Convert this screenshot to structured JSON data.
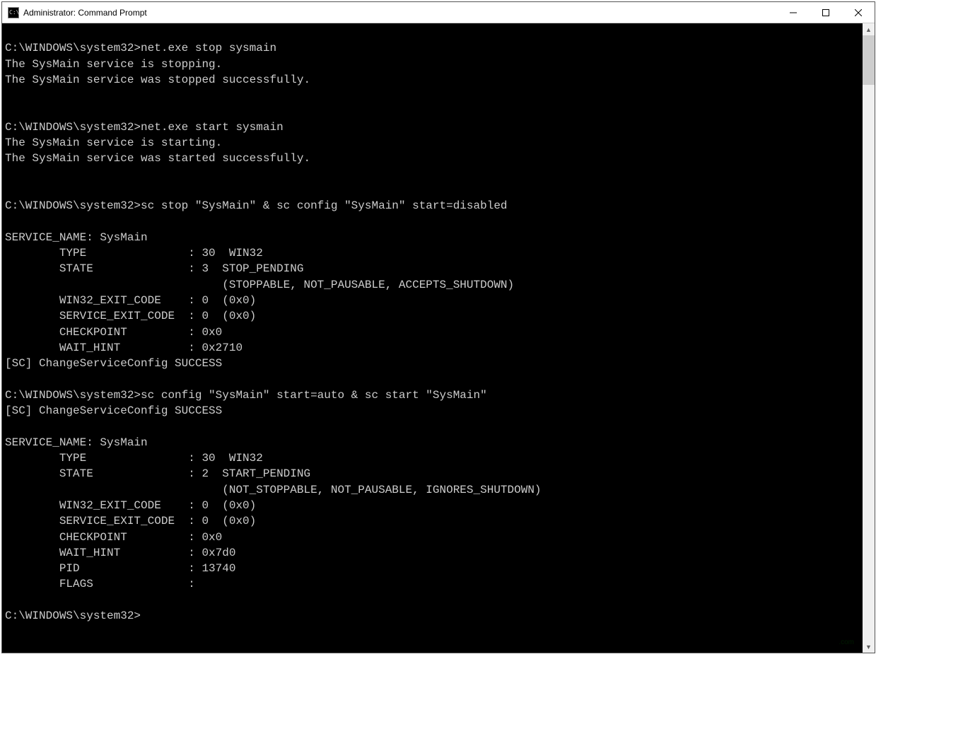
{
  "window": {
    "title": "Administrator: Command Prompt",
    "icon_label": "C:\\"
  },
  "terminal": {
    "lines": [
      "",
      "C:\\WINDOWS\\system32>net.exe stop sysmain",
      "The SysMain service is stopping.",
      "The SysMain service was stopped successfully.",
      "",
      "",
      "C:\\WINDOWS\\system32>net.exe start sysmain",
      "The SysMain service is starting.",
      "The SysMain service was started successfully.",
      "",
      "",
      "C:\\WINDOWS\\system32>sc stop \"SysMain\" & sc config \"SysMain\" start=disabled",
      "",
      "SERVICE_NAME: SysMain",
      "        TYPE               : 30  WIN32",
      "        STATE              : 3  STOP_PENDING",
      "                                (STOPPABLE, NOT_PAUSABLE, ACCEPTS_SHUTDOWN)",
      "        WIN32_EXIT_CODE    : 0  (0x0)",
      "        SERVICE_EXIT_CODE  : 0  (0x0)",
      "        CHECKPOINT         : 0x0",
      "        WAIT_HINT          : 0x2710",
      "[SC] ChangeServiceConfig SUCCESS",
      "",
      "C:\\WINDOWS\\system32>sc config \"SysMain\" start=auto & sc start \"SysMain\"",
      "[SC] ChangeServiceConfig SUCCESS",
      "",
      "SERVICE_NAME: SysMain",
      "        TYPE               : 30  WIN32",
      "        STATE              : 2  START_PENDING",
      "                                (NOT_STOPPABLE, NOT_PAUSABLE, IGNORES_SHUTDOWN)",
      "        WIN32_EXIT_CODE    : 0  (0x0)",
      "        SERVICE_EXIT_CODE  : 0  (0x0)",
      "        CHECKPOINT         : 0x0",
      "        WAIT_HINT          : 0x7d0",
      "        PID                : 13740",
      "        FLAGS              :",
      "",
      "C:\\WINDOWS\\system32>"
    ]
  },
  "watermark_text": ".com"
}
